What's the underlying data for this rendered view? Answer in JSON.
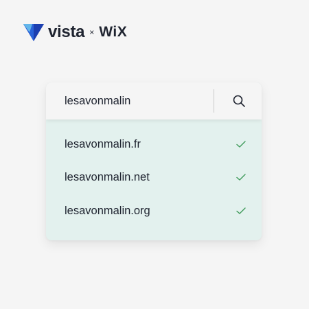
{
  "brand": {
    "vista": "vista",
    "x": "×",
    "wix": "WiX",
    "logo_icon": "vista-logo-icon",
    "colors": {
      "logo_dark": "#1c3fb0",
      "logo_mid": "#2a63d8",
      "logo_light": "#63b6ea",
      "text": "#1f2430"
    }
  },
  "search": {
    "value": "lesavonmalin",
    "icon": "search-icon"
  },
  "results": [
    {
      "domain": "lesavonmalin.fr",
      "icon": "check-icon"
    },
    {
      "domain": "lesavonmalin.net",
      "icon": "check-icon"
    },
    {
      "domain": "lesavonmalin.org",
      "icon": "check-icon"
    }
  ],
  "colors": {
    "page_background": "#f5f5f5",
    "results_background": "#e3f1ee",
    "check": "#3f9a5a"
  }
}
